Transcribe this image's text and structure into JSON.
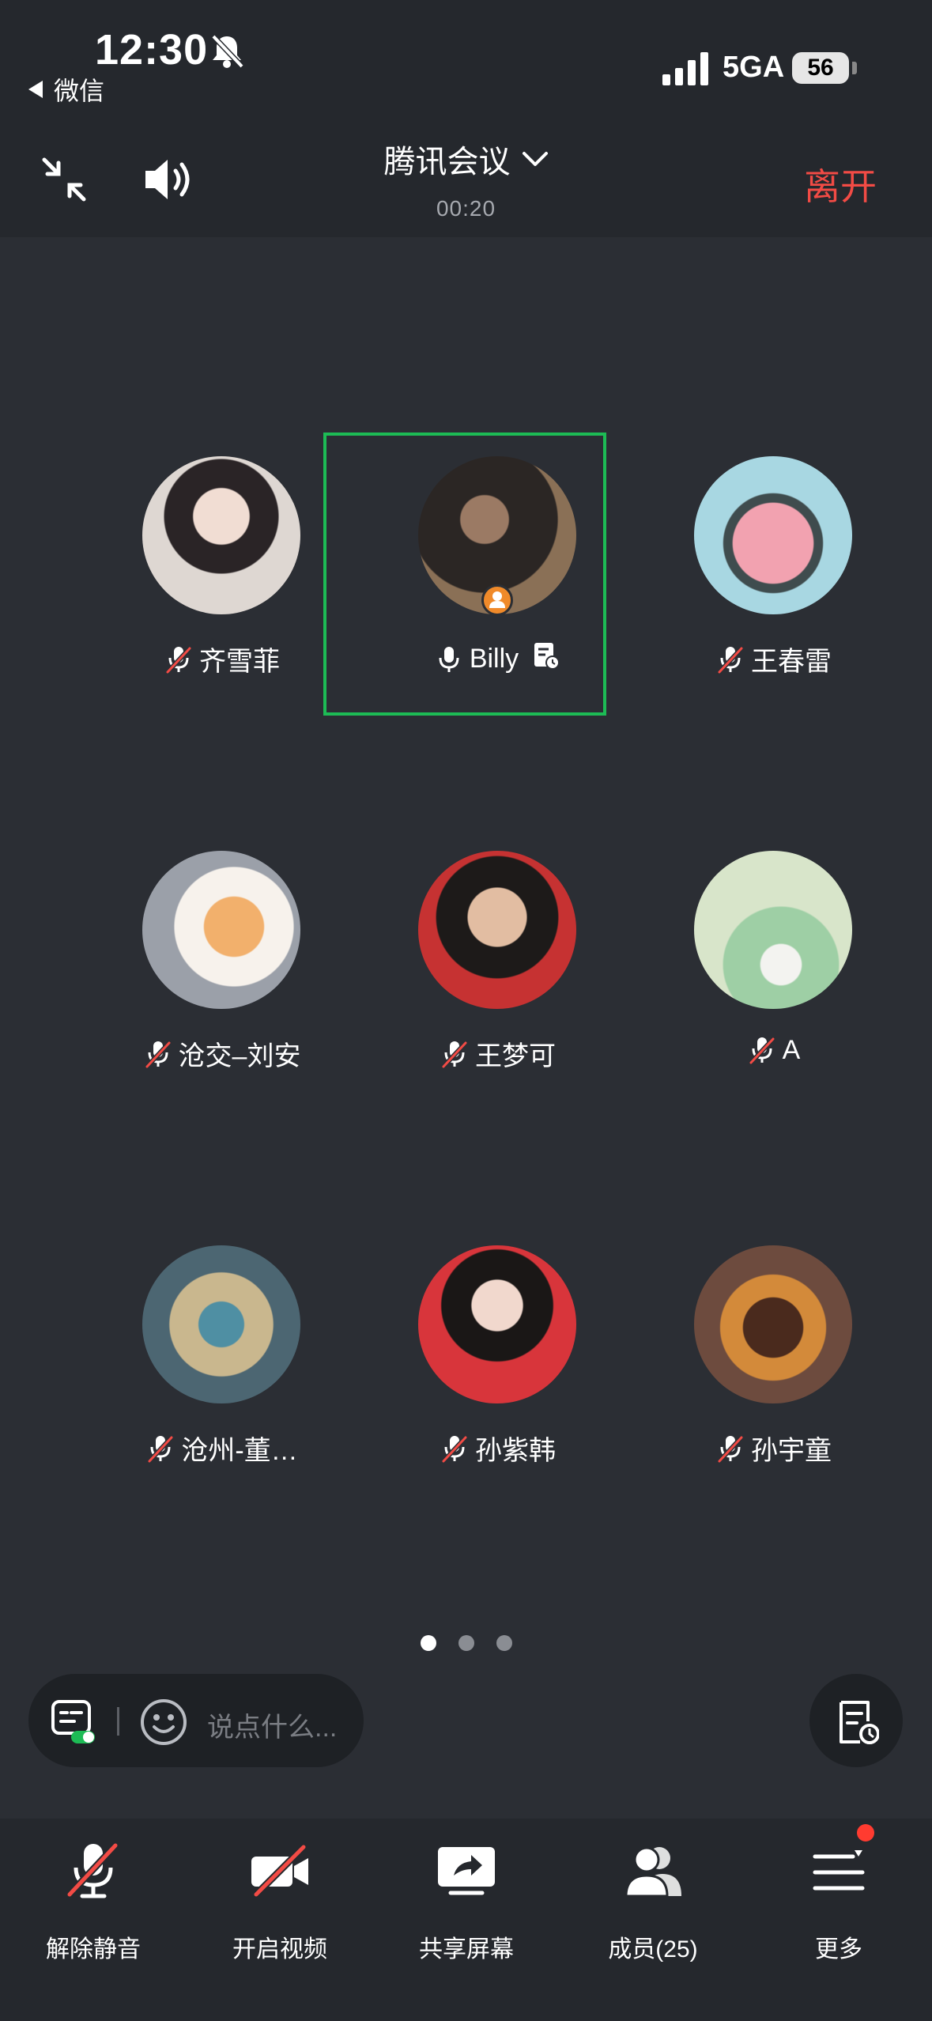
{
  "status_bar": {
    "time": "12:30",
    "back_app": "微信",
    "network": "5GA",
    "battery": "56"
  },
  "header": {
    "title": "腾讯会议",
    "timer": "00:20",
    "leave_label": "离开"
  },
  "participants": [
    {
      "name": "齐雪菲",
      "muted": true
    },
    {
      "name": "Billy",
      "muted": false,
      "host": true
    },
    {
      "name": "王春雷",
      "muted": true
    },
    {
      "name": "沧交–刘安",
      "muted": true
    },
    {
      "name": "王梦可",
      "muted": true
    },
    {
      "name": "A",
      "muted": true
    },
    {
      "name": "沧州-董…",
      "muted": true
    },
    {
      "name": "孙紫韩",
      "muted": true
    },
    {
      "name": "孙宇童",
      "muted": true
    }
  ],
  "pagination": {
    "pages": 3,
    "current": 1
  },
  "chat": {
    "placeholder": "说点什么..."
  },
  "toolbar": {
    "unmute_label": "解除静音",
    "video_label": "开启视频",
    "share_label": "共享屏幕",
    "members_label": "成员(25)",
    "more_label": "更多"
  },
  "colors": {
    "accent_green": "#1dbb55",
    "leave_red": "#f24b45",
    "host_orange": "#f08a2a",
    "background": "#2b2e34"
  }
}
